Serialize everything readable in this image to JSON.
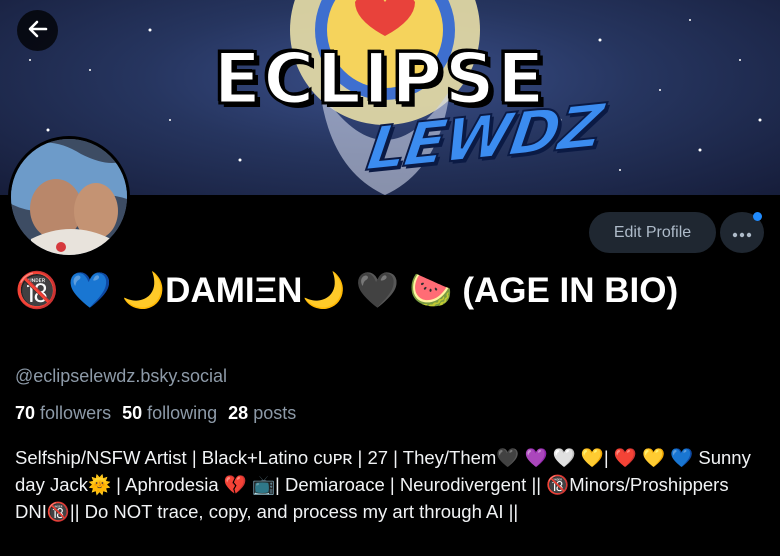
{
  "banner": {
    "logo_line1": "ECLIPSE",
    "logo_line2": "LEWDZ"
  },
  "profile": {
    "display_name": "🔞 💙 🌙DAMIΞN🌙 🖤 🍉 (AGE IN BIO)",
    "handle": "@eclipselewdz.bsky.social",
    "followers_count": "70",
    "followers_label": "followers",
    "following_count": "50",
    "following_label": "following",
    "posts_count": "28",
    "posts_label": "posts",
    "bio": "Selfship/NSFW Artist | Black+Latino ᴄᴜᴘʀ | 27 | They/Them🖤 💜 🤍 💛| ❤️ 💛 💙 Sunny day Jack🌞 | Aphrodesia 💔 📺| Demiaroace | Neurodivergent || 🔞Minors/Proshippers DNI🔞|| Do NOT trace, copy, and process my art through AI ||"
  },
  "actions": {
    "edit_profile_label": "Edit Profile"
  },
  "icons": {
    "back": "arrow-left-icon",
    "more": "ellipsis-icon"
  },
  "colors": {
    "accent": "#208bfe",
    "muted_text": "#8d9aa8",
    "button_bg": "#1f2731"
  }
}
